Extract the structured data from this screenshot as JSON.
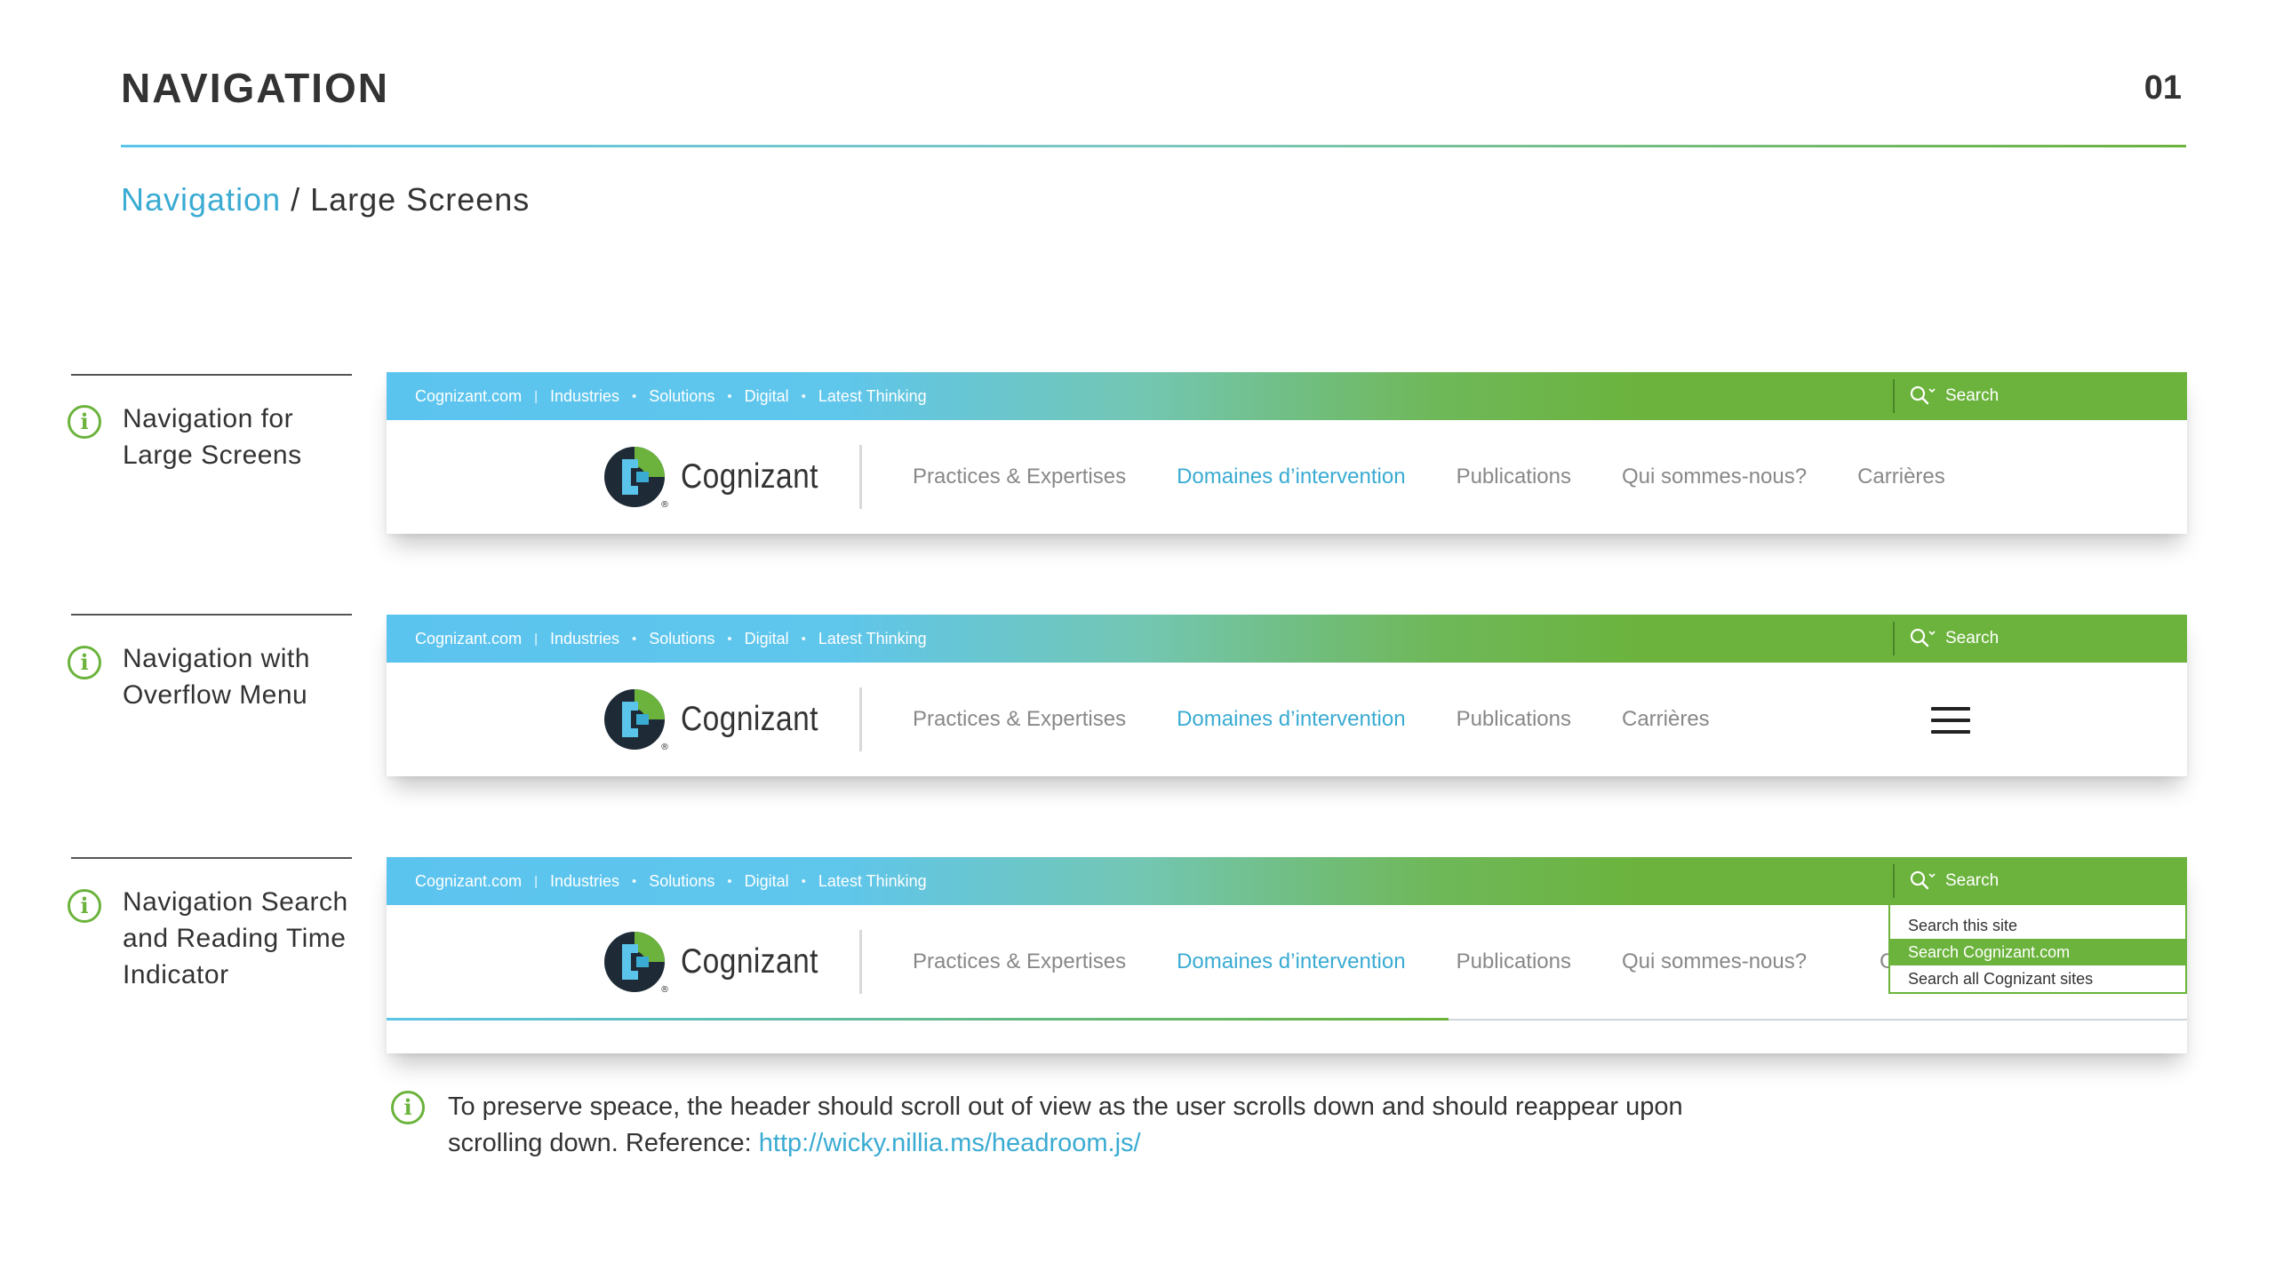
{
  "page": {
    "title": "NAVIGATION",
    "number": "01"
  },
  "breadcrumb": {
    "link": "Navigation",
    "separator": " / ",
    "current": "Large Screens"
  },
  "captions": [
    {
      "line1": "Navigation for",
      "line2": "Large Screens",
      "line3": ""
    },
    {
      "line1": "Navigation with",
      "line2": "Overflow Menu",
      "line3": ""
    },
    {
      "line1": "Navigation Search",
      "line2": "and Reading Time",
      "line3": "Indicator"
    }
  ],
  "utility_links": {
    "home": "Cognizant.com",
    "sep_bar": "|",
    "industries": "Industries",
    "sep_dot": "•",
    "solutions": "Solutions",
    "digital": "Digital",
    "thinking": "Latest Thinking"
  },
  "search": {
    "label": "Search",
    "options": [
      "Search this site",
      "Search Cognizant.com",
      "Search all Cognizant sites"
    ],
    "selected_index": 1
  },
  "logo": {
    "text": "Cognizant",
    "registered": "®"
  },
  "nav": {
    "practices": "Practices & Expertises",
    "domaines": "Domaines d’intervention",
    "publications": "Publications",
    "qui": "Qui sommes-nous?",
    "carrieres": "Carrières",
    "clipped": "C"
  },
  "reading_progress": 0.59,
  "footnote": {
    "text": "To preserve speace, the header should scroll out of view as the user scrolls down and should reappear upon scrolling down. Reference: ",
    "link": "http://wicky.nillia.ms/headroom.js/"
  },
  "icons": {
    "info": "info-circle-icon",
    "search": "search-icon",
    "menu": "hamburger-menu-icon"
  },
  "colors": {
    "accent_blue": "#3aabd2",
    "brand_green": "#6bb33c",
    "text_dark": "#333333",
    "nav_gray": "#888888"
  }
}
